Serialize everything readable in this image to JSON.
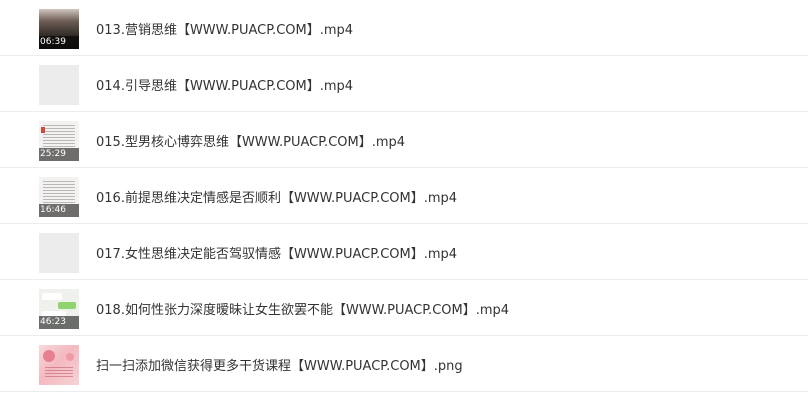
{
  "files": [
    {
      "name": "013.营销思维【WWW.PUACP.COM】.mp4",
      "duration": "06:39",
      "thumb_icon": "video-thumbnail-icon"
    },
    {
      "name": "014.引导思维【WWW.PUACP.COM】.mp4",
      "duration": "",
      "thumb_icon": "video-thumbnail-icon"
    },
    {
      "name": "015.型男核心博弈思维【WWW.PUACP.COM】.mp4",
      "duration": "25:29",
      "thumb_icon": "video-thumbnail-icon"
    },
    {
      "name": "016.前提思维决定情感是否顺利【WWW.PUACP.COM】.mp4",
      "duration": "16:46",
      "thumb_icon": "video-thumbnail-icon"
    },
    {
      "name": "017.女性思维决定能否驾驭情感【WWW.PUACP.COM】.mp4",
      "duration": "",
      "thumb_icon": "video-thumbnail-icon"
    },
    {
      "name": "018.如何性张力深度暧昧让女生欲罢不能【WWW.PUACP.COM】.mp4",
      "duration": "46:23",
      "thumb_icon": "video-thumbnail-icon"
    },
    {
      "name": "扫一扫添加微信获得更多干货课程【WWW.PUACP.COM】.png",
      "duration": "",
      "thumb_icon": "image-thumbnail-icon"
    }
  ]
}
